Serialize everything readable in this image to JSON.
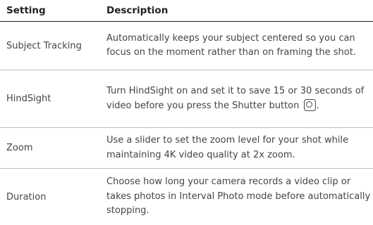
{
  "table": {
    "headers": {
      "setting": "Setting",
      "description": "Description"
    },
    "rows": [
      {
        "setting": "Subject Tracking",
        "description": "Automatically keeps your subject centered so you can focus on the moment rather than on framing the shot."
      },
      {
        "setting": "HindSight",
        "description_before_icon": "Turn HindSight on and set it to save 15 or 30 seconds of video before you press the Shutter button",
        "icon": "shutter-button-icon",
        "description_after_icon": "."
      },
      {
        "setting": "Zoom",
        "description": "Use a slider to set the zoom level for your shot while maintaining 4K video quality at 2x zoom."
      },
      {
        "setting": "Duration",
        "description": "Choose how long your camera records a video clip or takes photos in Interval Photo mode before automatically stopping."
      }
    ]
  }
}
